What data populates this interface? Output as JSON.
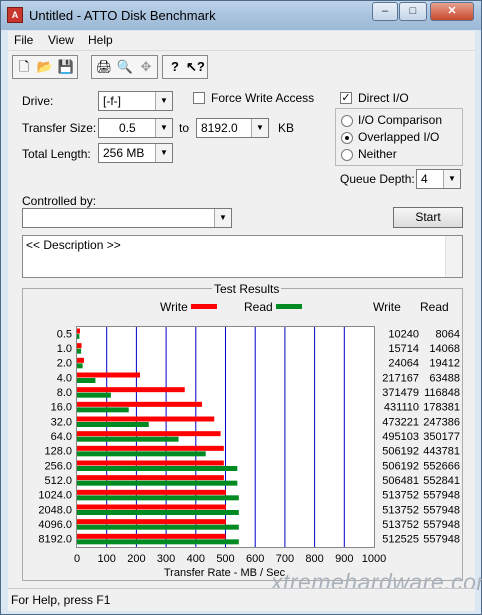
{
  "window": {
    "title": "Untitled - ATTO Disk Benchmark",
    "min": "–",
    "max": "□",
    "close": "✕"
  },
  "menu": [
    "File",
    "View",
    "Help"
  ],
  "toolbar": [
    "new-file-icon",
    "open-folder-icon",
    "save-icon",
    "print-icon",
    "print-preview-icon",
    "move-icon",
    "help-icon",
    "context-help-icon"
  ],
  "toolbar_glyphs": [
    "🗋",
    "📂",
    "💾",
    "🖨",
    "🔍",
    "✥",
    "?",
    "↖?"
  ],
  "drive": {
    "label": "Drive:",
    "value": "[-f-]"
  },
  "force_write": {
    "label": "Force Write Access",
    "checked": false
  },
  "direct_io": {
    "label": "Direct I/O",
    "checked": true
  },
  "transfer": {
    "label": "Transfer Size:",
    "from": "0.5",
    "to_label": "to",
    "to": "8192.0",
    "unit": "KB"
  },
  "total_length": {
    "label": "Total Length:",
    "value": "256 MB"
  },
  "io_modes": [
    {
      "label": "I/O Comparison",
      "selected": false
    },
    {
      "label": "Overlapped I/O",
      "selected": true
    },
    {
      "label": "Neither",
      "selected": false
    }
  ],
  "queue_depth": {
    "label": "Queue Depth:",
    "value": "4"
  },
  "controlled_by": {
    "label": "Controlled by:",
    "value": ""
  },
  "start_button": "Start",
  "description": "<< Description >>",
  "results": {
    "title": "Test Results",
    "write_col": "Write",
    "read_col": "Read",
    "legend_write": "Write",
    "legend_read": "Read"
  },
  "colors": {
    "write": "#ff0000",
    "read": "#008a22",
    "grid": "#0000cc"
  },
  "status": "For Help, press F1",
  "watermark": "xtremehardware.com",
  "chart_data": {
    "type": "bar",
    "orientation": "horizontal",
    "categories": [
      "0.5",
      "1.0",
      "2.0",
      "4.0",
      "8.0",
      "16.0",
      "32.0",
      "64.0",
      "128.0",
      "256.0",
      "512.0",
      "1024.0",
      "2048.0",
      "4096.0",
      "8192.0"
    ],
    "series": [
      {
        "name": "Write",
        "values": [
          10240,
          15714,
          24064,
          217167,
          371479,
          431110,
          473221,
          495103,
          506192,
          506192,
          506481,
          513752,
          513752,
          513752,
          512525
        ]
      },
      {
        "name": "Read",
        "values": [
          8064,
          14068,
          19412,
          63488,
          116848,
          178381,
          247386,
          350177,
          443781,
          552666,
          552841,
          557948,
          557948,
          557948,
          557948
        ]
      }
    ],
    "xlabel": "Transfer Rate - MB / Sec",
    "xticks": [
      "0",
      "100",
      "200",
      "300",
      "400",
      "500",
      "600",
      "700",
      "800",
      "900",
      "1000"
    ],
    "xlim": [
      0,
      1000
    ],
    "grid": true,
    "legend": "top"
  }
}
